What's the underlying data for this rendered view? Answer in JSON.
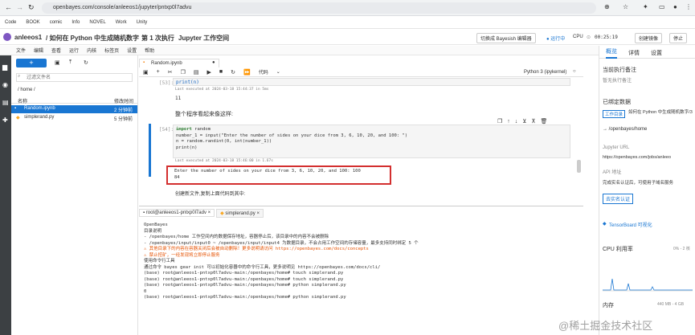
{
  "browser": {
    "url": "openbayes.com/console/anleeos1/jupyter/pntxp0l7advu"
  },
  "bookmarks": [
    "Code",
    "BOOK",
    "comic",
    "Info",
    "NOVEL",
    "Work",
    "Unity"
  ],
  "header": {
    "user": "anleeos1",
    "title": "/ 如何在 Python 中生成随机数字",
    "exec": "第 1 次执行",
    "suffix": "Jupyter 工作空间",
    "switch_btn": "切换成 Bayesish 编辑器",
    "running": "● 运行中",
    "cpu": "CPU",
    "timer": "00:25:19",
    "create_btn": "创建镜像",
    "stop_btn": "停止"
  },
  "menu": [
    "文件",
    "编辑",
    "查看",
    "运行",
    "内核",
    "标签页",
    "设置",
    "帮助"
  ],
  "filebrowser": {
    "new_btn": "+",
    "filter_placeholder": "过滤文件名",
    "path": "/ home /",
    "col_name": "名称",
    "col_modified": "修改时间",
    "files": [
      {
        "name": "Random.ipynb",
        "time": "2 分钟前",
        "selected": true
      },
      {
        "name": "simplerand.py",
        "time": "5 分钟前",
        "selected": false
      }
    ]
  },
  "notebook": {
    "tab": "Random.ipynb",
    "cell_type": "代码",
    "kernel": "Python 3 (ipykernel)",
    "cell1": {
      "prompt": "[53]:",
      "code": "print(n)",
      "exec": "Last executed at 2024-03-18 15:44:37 in 5ms",
      "output": "11"
    },
    "md1": "整个程序看起来像这样:",
    "cell2": {
      "prompt": "[54]:",
      "code": [
        "import random",
        "",
        "number_1 = input(\"Enter the number of sides on your dice from 3, 6, 10, 20, and 100: \")",
        "n = random.randint(0, int(number_1))",
        "print(n)"
      ],
      "exec": "Last executed at 2024-03-18 15:46:00 in 1.67s"
    },
    "output2": [
      "Enter the number of sides on your dice from 3, 6, 10, 20, and 100:  100",
      "84"
    ],
    "md2": "创建新文件,复制上面代码到其中:"
  },
  "terminal": {
    "tabs": [
      "root@anleeos1-pntxp0l7adv",
      "simplerand.py"
    ],
    "lines": [
      "OpenBayes",
      "",
      "目录说明",
      "",
      "- /openbayes/home 工作空间内的数据保存地址，容器停止后，该目录中的内容不会被删除",
      "- /openbayes/input/input0 ~ /openbayes/input/input4 为数据目录，不会占用工作空间的存储容量，最多支持同时绑定 5 个",
      "",
      "⚠ 其他目录下的内容在容器关闭后会被自动删除！更多说明请访问 https://openbayes.com/docs/concepts",
      "⚠ 禁止挖矿，一经发现将立即停止服务",
      "",
      "使用命令行工具",
      "",
      "通过命令 bayes gear init 可以初始化容器中的命令行工具，更多说明见 https://openbayes.com/docs/cli/",
      "",
      "(base) root@anleeos1-pntxp0l7advu-main:/openbayes/home# touch simplerand.py",
      "(base) root@anleeos1-pntxp0l7advu-main:/openbayes/home# touch simplerand.py",
      "(base) root@anleeos1-pntxp0l7advu-main:/openbayes/home# python simplerand.py",
      "0",
      "(base) root@anleeos1-pntxp0l7advu-main:/openbayes/home# python simplerand.py"
    ]
  },
  "rightpanel": {
    "tabs": [
      "概览",
      "详情",
      "设置"
    ],
    "last_note_title": "当前执行备注",
    "last_note": "暂无执行备注",
    "bound_title": "已绑定数据",
    "badge": "工作目录",
    "bound_name": "如何在 Python 中生成随机数字/3",
    "bound_path": "→ /openbayes/home",
    "url_label": "Jupyter URL",
    "url_value": "https://openbayes.com/jobs/anleeo",
    "api_label": "API 地址",
    "api_value": "完成实名认证后，可使用子域名服务",
    "api_btn": "去实名认证",
    "tensorboard": "TensorBoard 可视化",
    "cpu_label": "CPU 利用率",
    "cpu_value": "0% - 2 核",
    "mem_label": "内存",
    "mem_value": "440 MB - 4 GB"
  },
  "watermark": "@稀土掘金技术社区"
}
